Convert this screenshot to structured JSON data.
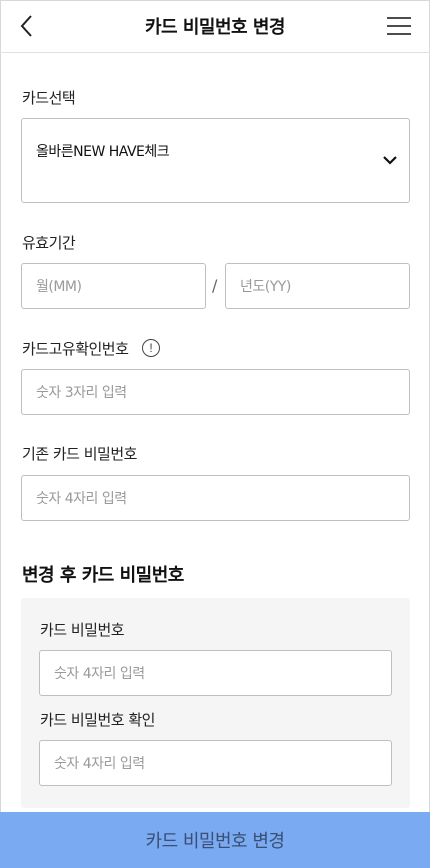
{
  "header": {
    "title": "카드 비밀번호 변경",
    "back_icon": "chevron-left-icon",
    "menu_icon": "hamburger-menu-icon"
  },
  "card_select": {
    "label": "카드선택",
    "value": "올바른NEW HAVE체크"
  },
  "expiry": {
    "label": "유효기간",
    "month_placeholder": "월(MM)",
    "separator": "/",
    "year_placeholder": "년도(YY)"
  },
  "cvc": {
    "label": "카드고유확인번호",
    "info_glyph": "!",
    "placeholder": "숫자 3자리 입력"
  },
  "old_pin": {
    "label": "기존 카드 비밀번호",
    "placeholder": "숫자 4자리 입력"
  },
  "new_section": {
    "title": "변경 후 카드 비밀번호",
    "pin_label": "카드 비밀번호",
    "pin_placeholder": "숫자 4자리 입력",
    "confirm_label": "카드 비밀번호 확인",
    "confirm_placeholder": "숫자 4자리 입력"
  },
  "submit": {
    "label": "카드 비밀번호 변경"
  },
  "colors": {
    "button_bg": "#7aaaf2",
    "button_text": "#3a4f73",
    "panel_bg": "#f5f5f5",
    "border": "#bfbfbf"
  }
}
